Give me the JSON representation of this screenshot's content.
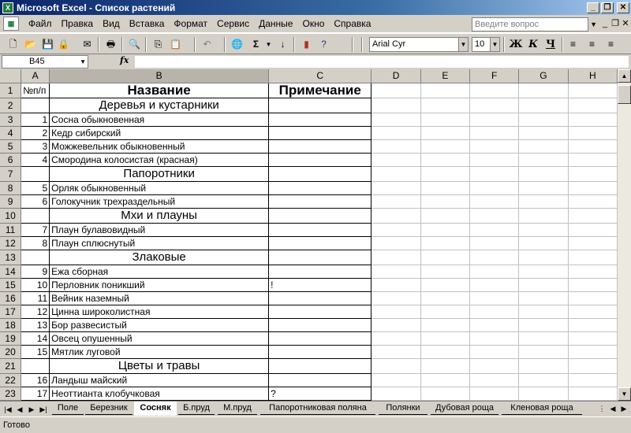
{
  "window": {
    "title": "Microsoft Excel - Список растений",
    "app_icon": "excel-icon"
  },
  "menu": [
    "Файл",
    "Правка",
    "Вид",
    "Вставка",
    "Формат",
    "Сервис",
    "Данные",
    "Окно",
    "Справка"
  ],
  "help_box": {
    "placeholder": "Введите вопрос"
  },
  "toolbar": {
    "font_name": "Arial Cyr",
    "font_size": "10",
    "bold": "Ж",
    "italic": "К",
    "underline": "Ч"
  },
  "formula_bar": {
    "cell_ref": "B45",
    "fx": "fx",
    "value": ""
  },
  "columns": [
    "A",
    "B",
    "C",
    "D",
    "E",
    "F",
    "G",
    "H"
  ],
  "rows": [
    {
      "n": "1",
      "a": "№п/п",
      "b": "Название",
      "c": "Примечание",
      "type": "header"
    },
    {
      "n": "2",
      "a": "",
      "b": "Деревья и кустарники",
      "c": "",
      "type": "section"
    },
    {
      "n": "3",
      "a": "1",
      "b": "Сосна обыкновенная",
      "c": "",
      "type": "item"
    },
    {
      "n": "4",
      "a": "2",
      "b": "Кедр сибирский",
      "c": "",
      "type": "item"
    },
    {
      "n": "5",
      "a": "3",
      "b": "Можжевельник обыкновенный",
      "c": "",
      "type": "item"
    },
    {
      "n": "6",
      "a": "4",
      "b": "Смородина колосистая (красная)",
      "c": "",
      "type": "item"
    },
    {
      "n": "7",
      "a": "",
      "b": "Папоротники",
      "c": "",
      "type": "section"
    },
    {
      "n": "8",
      "a": "5",
      "b": "Орляк обыкновенный",
      "c": "",
      "type": "item"
    },
    {
      "n": "9",
      "a": "6",
      "b": "Голокучник трехраздельный",
      "c": "",
      "type": "item"
    },
    {
      "n": "10",
      "a": "",
      "b": "Мхи и плауны",
      "c": "",
      "type": "section"
    },
    {
      "n": "11",
      "a": "7",
      "b": "Плаун булавовидный",
      "c": "",
      "type": "item"
    },
    {
      "n": "12",
      "a": "8",
      "b": "Плаун сплюснутый",
      "c": "",
      "type": "item"
    },
    {
      "n": "13",
      "a": "",
      "b": "Злаковые",
      "c": "",
      "type": "section"
    },
    {
      "n": "14",
      "a": "9",
      "b": "Ежа сборная",
      "c": "",
      "type": "item"
    },
    {
      "n": "15",
      "a": "10",
      "b": "Перловник поникший",
      "c": "!",
      "type": "item"
    },
    {
      "n": "16",
      "a": "11",
      "b": "Вейник наземный",
      "c": "",
      "type": "item"
    },
    {
      "n": "17",
      "a": "12",
      "b": "Цинна широколистная",
      "c": "",
      "type": "item"
    },
    {
      "n": "18",
      "a": "13",
      "b": "Бор развесистый",
      "c": "",
      "type": "item"
    },
    {
      "n": "19",
      "a": "14",
      "b": "Овсец опушенный",
      "c": "",
      "type": "item"
    },
    {
      "n": "20",
      "a": "15",
      "b": "Мятлик луговой",
      "c": "",
      "type": "item"
    },
    {
      "n": "21",
      "a": "",
      "b": "Цветы и травы",
      "c": "",
      "type": "section"
    },
    {
      "n": "22",
      "a": "16",
      "b": "Ландыш майский",
      "c": "",
      "type": "item"
    },
    {
      "n": "23",
      "a": "17",
      "b": "Неоттианта клобучковая",
      "c": "?",
      "type": "item"
    }
  ],
  "sheets": [
    {
      "label": "Поле",
      "active": false
    },
    {
      "label": "Березник",
      "active": false
    },
    {
      "label": "Сосняк",
      "active": true
    },
    {
      "label": "Б.пруд",
      "active": false
    },
    {
      "label": "М.пруд",
      "active": false
    },
    {
      "label": "Папоротниковая поляна",
      "active": false
    },
    {
      "label": "Полянки",
      "active": false
    },
    {
      "label": "Дубовая роща",
      "active": false
    },
    {
      "label": "Кленовая роща",
      "active": false
    }
  ],
  "status": "Готово"
}
